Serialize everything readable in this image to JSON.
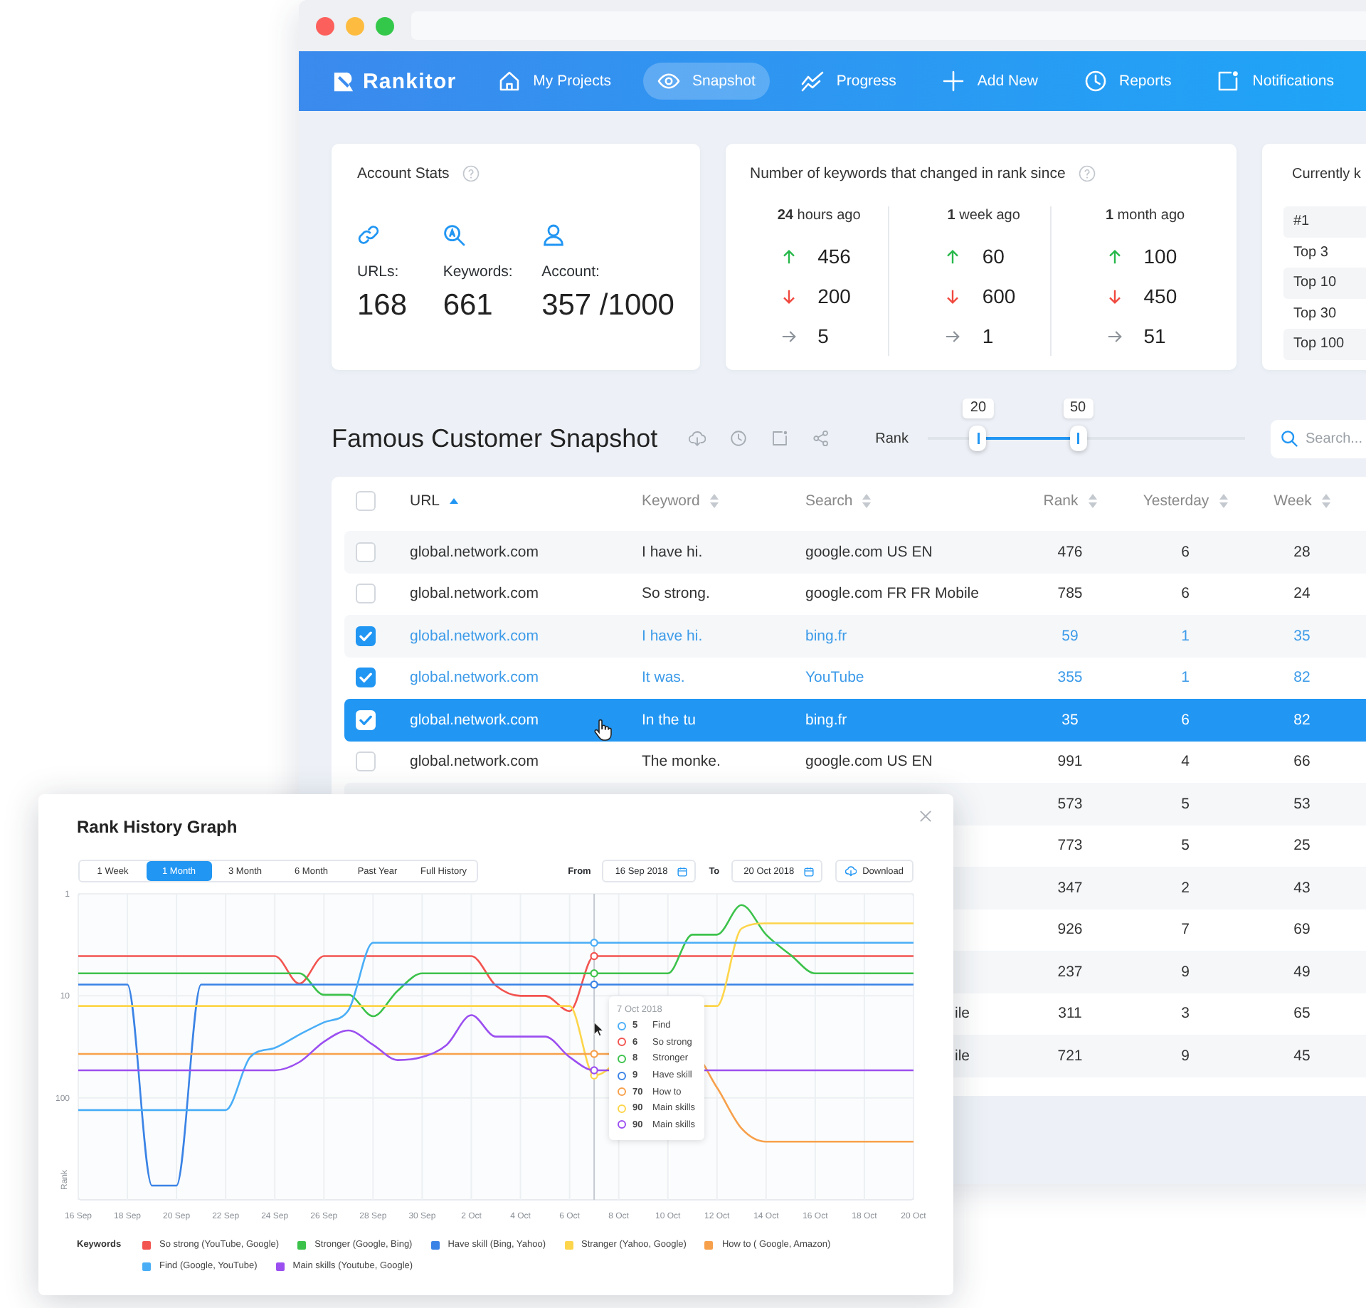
{
  "window": {
    "controls": [
      {
        "color": "#fc605c"
      },
      {
        "color": "#fdbc40"
      },
      {
        "color": "#34c84a"
      }
    ]
  },
  "nav": {
    "brand": "Rankitor",
    "items": [
      {
        "label": "My Projects",
        "selected": false
      },
      {
        "label": "Snapshot",
        "selected": true
      },
      {
        "label": "Progress",
        "selected": false
      },
      {
        "label": "Add New",
        "selected": false
      },
      {
        "label": "Reports",
        "selected": false
      },
      {
        "label": "Notifications",
        "selected": false
      }
    ]
  },
  "account_stats": {
    "title": "Account Stats",
    "stats": [
      {
        "label": "URLs:",
        "value": "168"
      },
      {
        "label": "Keywords:",
        "value": "661"
      },
      {
        "label": "Account:",
        "value": "357 /1000"
      }
    ]
  },
  "rank_changes": {
    "title": "Number of keywords that changed in rank since",
    "periods": [
      {
        "heading": "**24** hours ago",
        "rows": [
          {
            "kind": "up",
            "value": "456"
          },
          {
            "kind": "down",
            "value": "200"
          },
          {
            "kind": "same",
            "value": "5"
          }
        ]
      },
      {
        "heading": "**1** week ago",
        "rows": [
          {
            "kind": "up",
            "value": "60"
          },
          {
            "kind": "down",
            "value": "600"
          },
          {
            "kind": "same",
            "value": "1"
          }
        ]
      },
      {
        "heading": "**1** month ago",
        "rows": [
          {
            "kind": "up",
            "value": "100"
          },
          {
            "kind": "down",
            "value": "450"
          },
          {
            "kind": "same",
            "value": "51"
          }
        ]
      }
    ]
  },
  "ranking_card": {
    "title": "Currently k",
    "rows": [
      "#1",
      "Top 3",
      "Top 10",
      "Top 30",
      "Top 100"
    ]
  },
  "snapshot": {
    "title": "Famous Customer Snapshot",
    "slider": {
      "label": "Rank",
      "thumbs": [
        {
          "value": "20",
          "level": 0.157
        },
        {
          "value": "50",
          "level": 0.471
        }
      ]
    },
    "search": {
      "placeholder": "Search..."
    }
  },
  "table": {
    "header_checked": false,
    "columns": [
      {
        "label": "URL",
        "sorted": true
      },
      {
        "label": "Keyword",
        "sorted": false
      },
      {
        "label": "Search",
        "sorted": false
      },
      {
        "label": "Rank",
        "sorted": false
      },
      {
        "label": "Yesterday",
        "sorted": false
      },
      {
        "label": "Week",
        "sorted": false
      }
    ],
    "rows": [
      {
        "checked": false,
        "selected": false,
        "url": "global.network.com",
        "keyword": "I have hi.",
        "search": "google.com US EN",
        "rank": "476",
        "yesterday": "6",
        "week": "28"
      },
      {
        "checked": false,
        "selected": false,
        "url": "global.network.com",
        "keyword": "So strong.",
        "search": "google.com FR FR Mobile",
        "rank": "785",
        "yesterday": "6",
        "week": "24"
      },
      {
        "checked": true,
        "selected": false,
        "url": "global.network.com",
        "keyword": "I have hi.",
        "search": "bing.fr",
        "rank": "59",
        "yesterday": "1",
        "week": "35"
      },
      {
        "checked": true,
        "selected": false,
        "url": "global.network.com",
        "keyword": "It was.",
        "search": "YouTube",
        "rank": "355",
        "yesterday": "1",
        "week": "82"
      },
      {
        "checked": true,
        "selected": true,
        "url": "global.network.com",
        "keyword": "In the tu",
        "search": "bing.fr",
        "rank": "35",
        "yesterday": "6",
        "week": "82"
      },
      {
        "checked": false,
        "selected": false,
        "url": "global.network.com",
        "keyword": "The monke.",
        "search": "google.com US EN",
        "rank": "991",
        "yesterday": "4",
        "week": "66"
      },
      {
        "selected": false,
        "rank": "573",
        "yesterday": "5",
        "week": "53"
      },
      {
        "selected": false,
        "rank": "773",
        "yesterday": "5",
        "week": "25"
      },
      {
        "selected": false,
        "rank": "347",
        "yesterday": "2",
        "week": "43"
      },
      {
        "selected": false,
        "rank": "926",
        "yesterday": "7",
        "week": "69"
      },
      {
        "selected": false,
        "rank": "237",
        "yesterday": "9",
        "week": "49"
      },
      {
        "selected": false,
        "search": "ile",
        "rank": "311",
        "yesterday": "3",
        "week": "65"
      },
      {
        "selected": false,
        "search": "ile",
        "rank": "721",
        "yesterday": "9",
        "week": "45"
      }
    ]
  },
  "dialog": {
    "title": "Rank History Graph",
    "ranges": [
      {
        "label": "1 Week",
        "selected": false
      },
      {
        "label": "1 Month",
        "selected": true
      },
      {
        "label": "3 Month",
        "selected": false
      },
      {
        "label": "6 Month",
        "selected": false
      },
      {
        "label": "Past Year",
        "selected": false
      },
      {
        "label": "Full History",
        "selected": false
      }
    ],
    "dates": [
      {
        "label": "From",
        "value": "16 Sep 2018"
      },
      {
        "label": "To",
        "value": "20 Oct 2018"
      }
    ],
    "download": "Download",
    "graph": {
      "ylabel": "Rank",
      "y_axis_labels": [
        "1",
        "10",
        "100"
      ],
      "x_axis_labels": [
        "16 Sep",
        "18 Sep",
        "20 Sep",
        "22 Sep",
        "24 Sep",
        "26 Sep",
        "28 Sep",
        "30 Sep",
        "2 Oct",
        "4 Oct",
        "6 Oct",
        "8 Oct",
        "10 Oct",
        "12 Oct",
        "14 Oct",
        "16 Oct",
        "18 Oct",
        "20 Oct"
      ],
      "legend": [
        {
          "label": "So strong (YouTube, Google)",
          "color": "#f25450"
        },
        {
          "label": "Stronger (Google, Bing)",
          "color": "#3cc24b"
        },
        {
          "label": "Have skill (Bing, Yahoo)",
          "color": "#3a83e6"
        },
        {
          "label": "Stranger (Yahoo, Google)",
          "color": "#fdd54b"
        },
        {
          "label": "How to ( Google, Amazon)",
          "color": "#f7a04b"
        },
        {
          "label": "Find (Google, YouTube)",
          "color": "#4aaef7"
        },
        {
          "label": "Main skills (Youtube, Google)",
          "color": "#9b4ff0"
        }
      ]
    },
    "tooltip": {
      "title": "7 Oct 2018",
      "items": [
        {
          "value": "5",
          "label": "Find",
          "color": "#4aaef7"
        },
        {
          "value": "6",
          "label": "So strong",
          "color": "#f25450"
        },
        {
          "value": "8",
          "label": "Stronger",
          "color": "#3cc24b"
        },
        {
          "value": "9",
          "label": "Have skill",
          "color": "#3a83e6"
        },
        {
          "value": "70",
          "label": "How to",
          "color": "#f7a04b"
        },
        {
          "value": "90",
          "label": "Main skills",
          "color": "#fdd54b"
        },
        {
          "value": "90",
          "label": "Main skills",
          "color": "#9b4ff0"
        }
      ]
    },
    "legend_title": "Keywords"
  }
}
